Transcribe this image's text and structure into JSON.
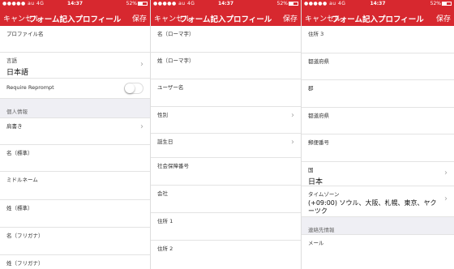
{
  "status": {
    "carrier": "●●●●● au 4G",
    "time": "14:37",
    "battery_text": "52%"
  },
  "nav": {
    "cancel": "キャンセル",
    "title": "フォーム記入プロフィール",
    "save": "保存"
  },
  "screen1": {
    "profile_name_label": "プロファイル名",
    "language_label": "言語",
    "language_value": "日本語",
    "reprompt_label": "Require Reprompt",
    "section_personal": "個人情報",
    "title_label": "肩書き",
    "given_name_label": "名（標準）",
    "middle_name_label": "ミドルネーム",
    "family_name_label": "姓（標準）",
    "given_kana_label": "名（フリガナ）",
    "family_kana_label": "姓（フリガナ）"
  },
  "screen2": {
    "given_roman_label": "名（ローマ字）",
    "family_roman_label": "姓（ローマ字）",
    "username_label": "ユーザー名",
    "gender_label": "性別",
    "birthday_label": "誕生日",
    "ssn_label": "社会保障番号",
    "company_label": "会社",
    "address1_label": "住所 1",
    "address2_label": "住所 2"
  },
  "screen3": {
    "address3_label": "住所 3",
    "prefecture_label": "都道府県",
    "county_label": "郡",
    "prefecture2_label": "都道府県",
    "postal_label": "郵便番号",
    "country_label": "国",
    "country_value": "日本",
    "timezone_label": "タイムゾーン",
    "timezone_value": "(+09:00) ソウル、大阪、札幌、東京、ヤクーツク",
    "section_contact": "連絡先情報",
    "email_label": "メール"
  },
  "colors": {
    "accent": "#d7282f",
    "section_bg": "#efeff4"
  }
}
